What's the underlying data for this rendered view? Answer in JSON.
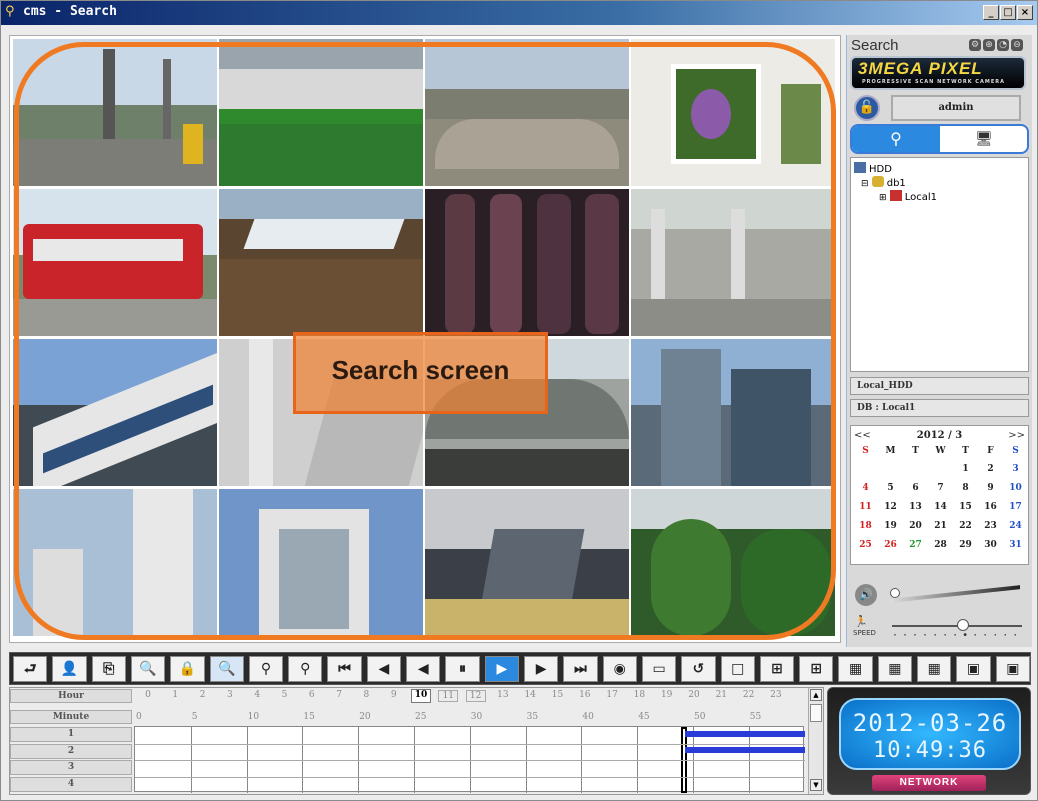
{
  "window": {
    "title": "cms - Search",
    "min": "_",
    "max": "□",
    "close": "×"
  },
  "overlay": {
    "label": "Search screen"
  },
  "panel": {
    "title": "Search",
    "logo_main": "3MEGA PIXEL",
    "logo_sub": "PROGRESSIVE SCAN  NETWORK CAMERA",
    "user": "admin",
    "tree": [
      {
        "label": "HDD"
      },
      {
        "label": "db1"
      },
      {
        "label": "Local1"
      }
    ],
    "info1": "Local_HDD",
    "info2": "DB : Local1",
    "volume": 0.0,
    "speed": 0.55,
    "speed_label": "SPEED"
  },
  "calendar": {
    "prev": "<<",
    "next": ">>",
    "month": "2012 / 3",
    "weekdays": [
      "S",
      "M",
      "T",
      "W",
      "T",
      "F",
      "S"
    ],
    "weeks": [
      [
        "",
        "",
        "",
        "",
        "1",
        "2",
        "3"
      ],
      [
        "4",
        "5",
        "6",
        "7",
        "8",
        "9",
        "10"
      ],
      [
        "11",
        "12",
        "13",
        "14",
        "15",
        "16",
        "17"
      ],
      [
        "18",
        "19",
        "20",
        "21",
        "22",
        "23",
        "24"
      ],
      [
        "25",
        "26",
        "27",
        "28",
        "29",
        "30",
        "31"
      ]
    ],
    "colors": {
      "sunday": "#d42020",
      "saturday": "#2050c8",
      "marked_red": "#d42020",
      "marked_green": "#1f9a2a"
    },
    "marked": {
      "26": "red",
      "27": "green"
    }
  },
  "toolbar": {
    "buttons": [
      {
        "name": "export-button",
        "glyph": "⮐"
      },
      {
        "name": "user-button",
        "glyph": "👤"
      },
      {
        "name": "backup-button",
        "glyph": "⎘"
      },
      {
        "name": "search-db-button",
        "glyph": "🔍"
      },
      {
        "name": "lock-button",
        "glyph": "🔒"
      },
      {
        "name": "search-mode-button",
        "glyph": "🔍"
      },
      {
        "name": "event-search-button",
        "glyph": "⚲"
      },
      {
        "name": "zoom-search-button",
        "glyph": "⚲"
      },
      {
        "name": "first-frame-button",
        "glyph": "⏮"
      },
      {
        "name": "step-back-button",
        "glyph": "◀"
      },
      {
        "name": "reverse-play-button",
        "glyph": "◀"
      },
      {
        "name": "pause-button",
        "glyph": "⏸"
      },
      {
        "name": "play-button",
        "glyph": "▶"
      },
      {
        "name": "step-forward-button",
        "glyph": "▶"
      },
      {
        "name": "last-frame-button",
        "glyph": "⏭"
      },
      {
        "name": "snapshot-button",
        "glyph": "◉"
      },
      {
        "name": "print-button",
        "glyph": "▭"
      },
      {
        "name": "refresh-button",
        "glyph": "↺"
      },
      {
        "name": "layout-1-button",
        "glyph": "□"
      },
      {
        "name": "layout-4-button",
        "glyph": "⊞"
      },
      {
        "name": "layout-9-button",
        "glyph": "⊞"
      },
      {
        "name": "layout-16-button",
        "glyph": "▦"
      },
      {
        "name": "layout-6-button",
        "glyph": "▦"
      },
      {
        "name": "layout-8-button",
        "glyph": "▦"
      },
      {
        "name": "layout-10-button",
        "glyph": "▣"
      },
      {
        "name": "layout-13-button",
        "glyph": "▣"
      }
    ]
  },
  "timeline": {
    "hour_label": "Hour",
    "minute_label": "Minute",
    "hours": [
      "0",
      "1",
      "2",
      "3",
      "4",
      "5",
      "6",
      "7",
      "8",
      "9",
      "10",
      "11",
      "12",
      "13",
      "14",
      "15",
      "16",
      "17",
      "18",
      "19",
      "20",
      "21",
      "22",
      "23"
    ],
    "selected_hour": "10",
    "minutes": [
      "0",
      "5",
      "10",
      "15",
      "20",
      "25",
      "30",
      "35",
      "40",
      "45",
      "50",
      "55"
    ],
    "channels": [
      "1",
      "2",
      "3",
      "4"
    ],
    "record_color": "#2a3cd8"
  },
  "clock": {
    "date": "2012-03-26",
    "time": "10:49:36",
    "network_label": "NETWORK"
  }
}
